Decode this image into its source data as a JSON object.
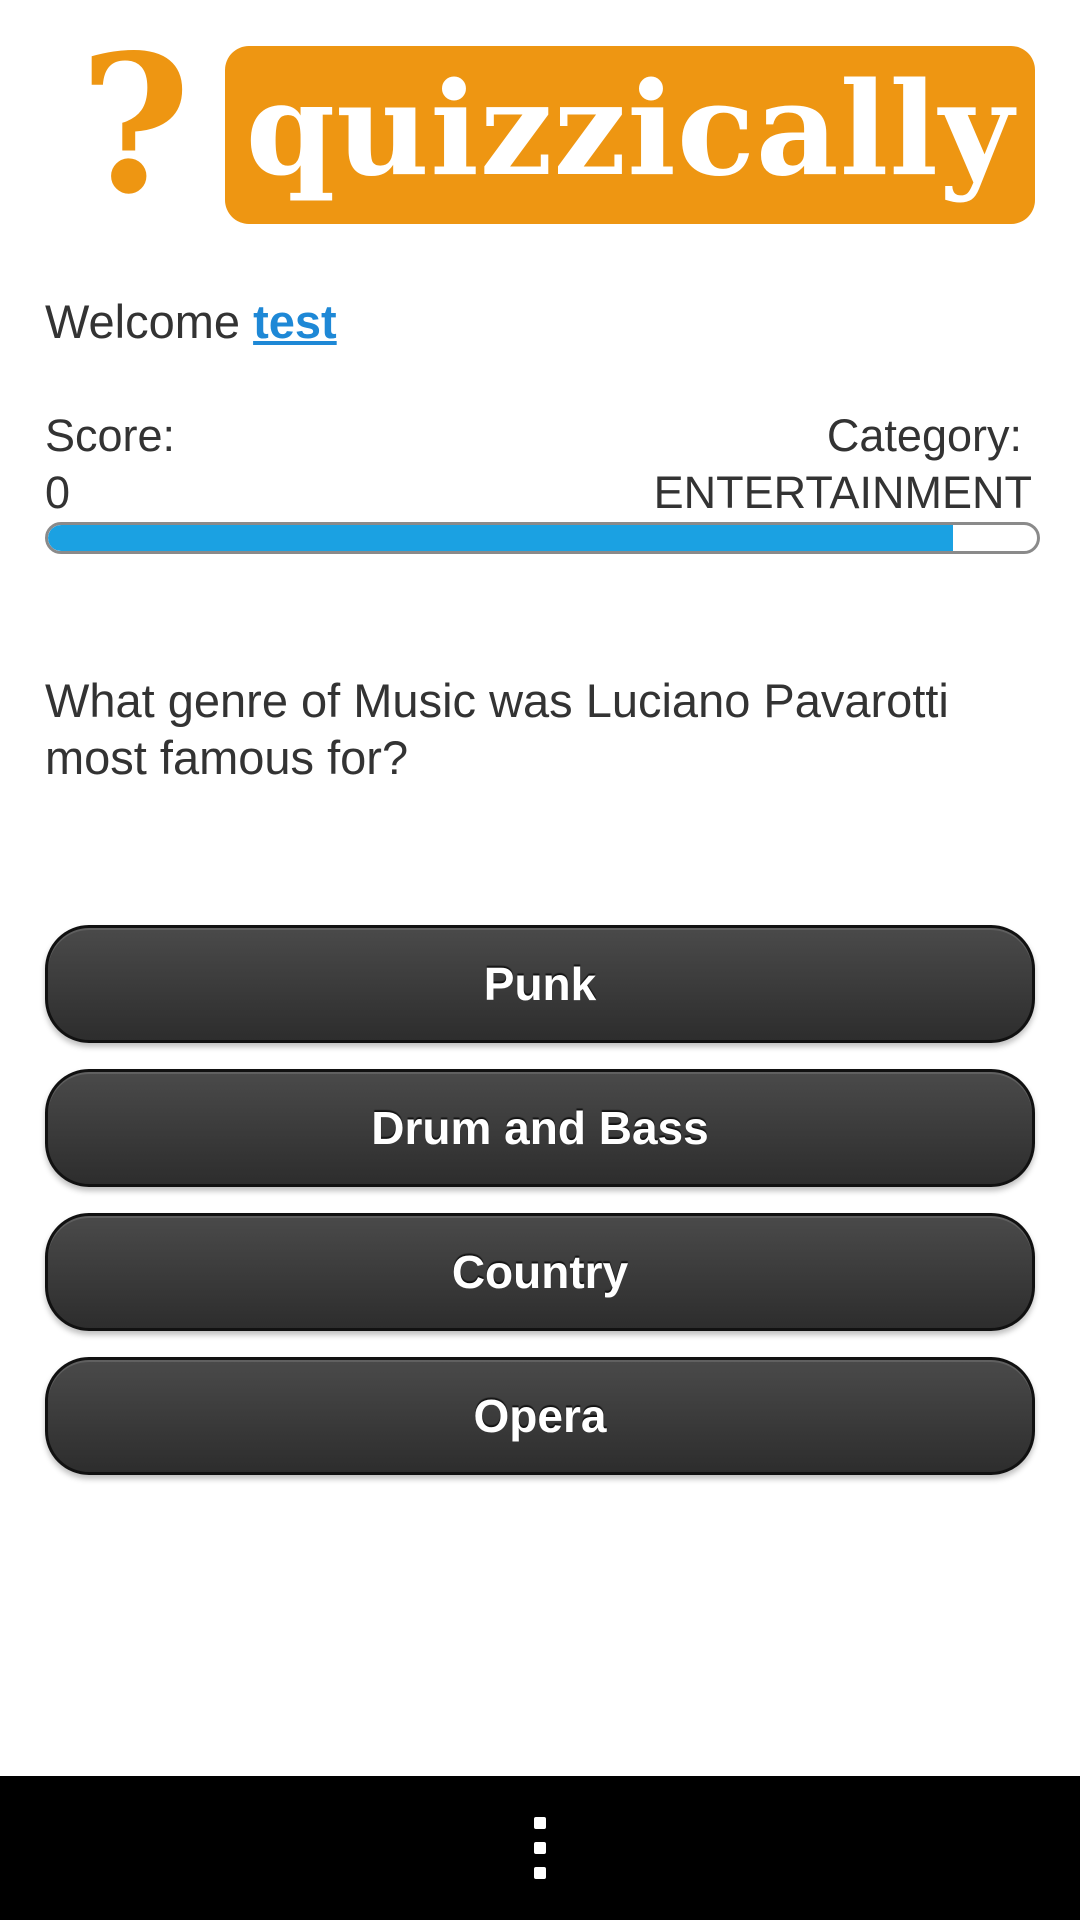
{
  "header": {
    "logo_mark": "?",
    "brand_name": "quizzically",
    "brand_color": "#EE9612"
  },
  "welcome": {
    "greeting": "Welcome",
    "username": "test"
  },
  "stats": {
    "score_label": "Score:",
    "score_value": "0",
    "category_label": "Category:",
    "category_value": "ENTERTAINMENT"
  },
  "progress": {
    "fraction": 0.915,
    "fill_color": "#1BA1E2"
  },
  "question": {
    "text": "What genre of Music was Luciano Pavarotti most famous for?"
  },
  "answers": [
    {
      "label": "Punk"
    },
    {
      "label": "Drum and Bass"
    },
    {
      "label": "Country"
    },
    {
      "label": "Opera"
    }
  ],
  "navbar": {
    "menu_icon": "overflow-menu-icon"
  }
}
